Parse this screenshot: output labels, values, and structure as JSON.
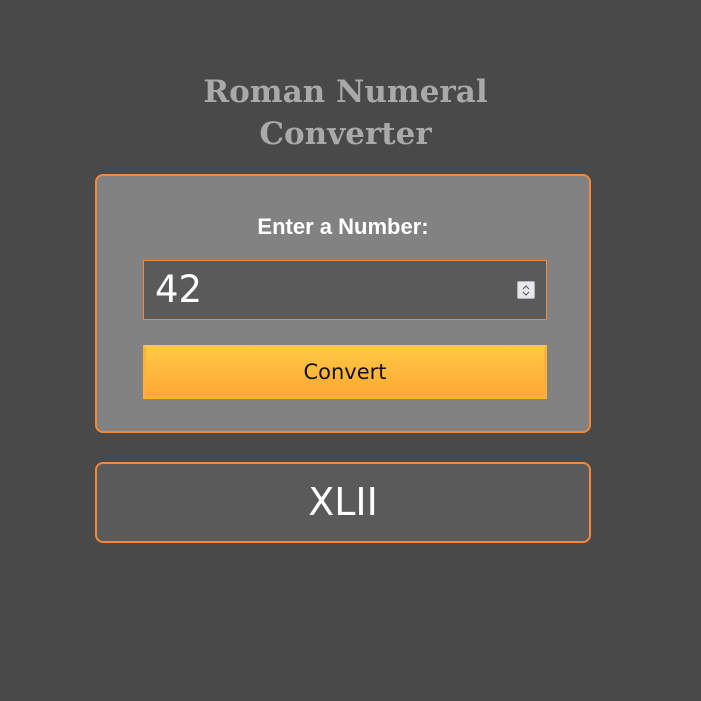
{
  "title": {
    "line1": "Roman Numeral",
    "line2": "Converter"
  },
  "form": {
    "label": "Enter a Number:",
    "input_value": "42",
    "button_label": "Convert"
  },
  "result": {
    "value": "XLII"
  },
  "colors": {
    "background": "#494949",
    "card": "#828282",
    "accent_border": "#f08a3c",
    "button": "#ffb236",
    "title_text": "#a9a9a9"
  },
  "icons": {
    "spinner": "up-down-arrows-icon"
  }
}
